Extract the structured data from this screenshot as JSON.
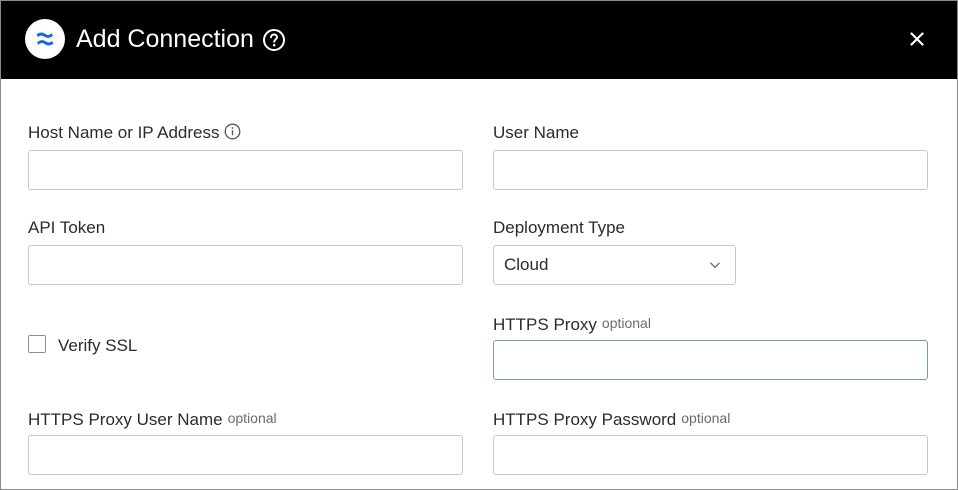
{
  "dialog": {
    "title": "Add Connection",
    "logo_icon": "confluence-logo-icon",
    "help_icon": "help-circle-icon",
    "close_icon": "close-icon"
  },
  "fields": {
    "host": {
      "label": "Host Name or IP Address",
      "value": "",
      "info_icon": "info-circle-icon"
    },
    "user_name": {
      "label": "User Name",
      "value": ""
    },
    "api_token": {
      "label": "API Token",
      "value": ""
    },
    "deployment_type": {
      "label": "Deployment Type",
      "selected": "Cloud"
    },
    "verify_ssl": {
      "label": "Verify SSL",
      "checked": false
    },
    "https_proxy": {
      "label": "HTTPS Proxy",
      "optional": "optional",
      "value": ""
    },
    "https_proxy_user": {
      "label": "HTTPS Proxy User Name",
      "optional": "optional",
      "value": ""
    },
    "https_proxy_password": {
      "label": "HTTPS Proxy Password",
      "optional": "optional",
      "value": ""
    }
  },
  "colors": {
    "header_bg": "#000000",
    "logo_blue": "#1868DB",
    "focus_border": "#7b9ac3"
  }
}
